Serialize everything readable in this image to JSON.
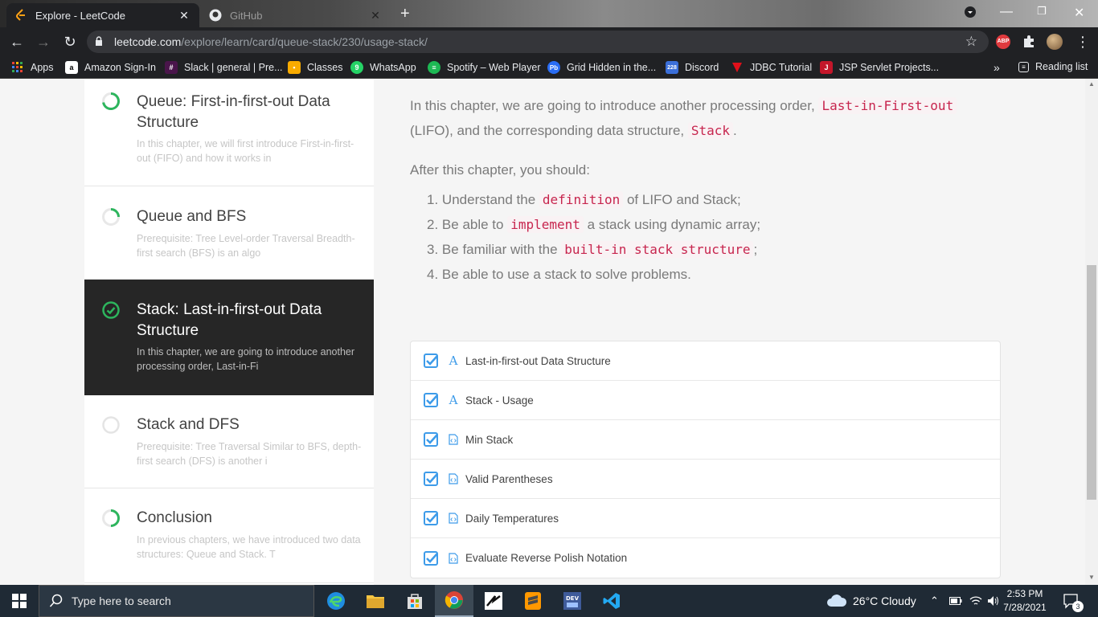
{
  "browser": {
    "tabs": [
      {
        "title": "Explore - LeetCode",
        "active": true
      },
      {
        "title": "GitHub",
        "active": false
      }
    ],
    "url_host": "leetcode.com",
    "url_path": "/explore/learn/card/queue-stack/230/usage-stack/",
    "ext_badge": "ABP"
  },
  "bookmarks": [
    {
      "label": "Apps",
      "icon": "apps-grid-icon",
      "color": "#ea4335"
    },
    {
      "label": "Amazon Sign-In",
      "icon": "amazon-icon",
      "color": "#ffffff"
    },
    {
      "label": "Slack | general | Pre...",
      "icon": "slack-icon",
      "color": "#4a154b"
    },
    {
      "label": "Classes",
      "icon": "classroom-icon",
      "color": "#f9ab00"
    },
    {
      "label": "WhatsApp",
      "icon": "whatsapp-icon",
      "color": "#25d366"
    },
    {
      "label": "Spotify – Web Player",
      "icon": "spotify-icon",
      "color": "#1db954"
    },
    {
      "label": "Grid Hidden in the...",
      "icon": "pb-icon",
      "color": "#2a6df4"
    },
    {
      "label": "Discord",
      "icon": "calendar-icon",
      "color": "#3b6fd9"
    },
    {
      "label": "JDBC Tutorial",
      "icon": "javatpoint-icon",
      "color": "#e0101a"
    },
    {
      "label": "JSP Servlet Projects...",
      "icon": "jsp-icon",
      "color": "#c4162a"
    }
  ],
  "reading_list_label": "Reading list",
  "sidebar": {
    "chapters": [
      {
        "title": "Queue: First-in-first-out Data Structure",
        "desc": "In this chapter, we will first introduce First-in-first-out (FIFO) and how it works in",
        "status": "in-progress"
      },
      {
        "title": "Queue and BFS",
        "desc": "Prerequisite: Tree Level-order Traversal Breadth-first search (BFS) is an algo",
        "status": "in-progress"
      },
      {
        "title": "Stack: Last-in-first-out Data Structure",
        "desc": "In this chapter, we are going to introduce another processing order, Last-in-Fi",
        "status": "completed"
      },
      {
        "title": "Stack and DFS",
        "desc": "Prerequisite: Tree Traversal Similar to BFS, depth-first search (DFS) is another i",
        "status": "not-started"
      },
      {
        "title": "Conclusion",
        "desc": "In previous chapters, we have introduced two data structures: Queue and Stack. T",
        "status": "in-progress"
      }
    ]
  },
  "content": {
    "intro_1": "In this chapter, we are going to introduce another processing order,",
    "intro_code_1": "Last-in-First-out",
    "intro_2": "(LIFO), and the corresponding data structure,",
    "intro_code_2": "Stack",
    "intro_3": ".",
    "after_text": "After this chapter, you should:",
    "objectives": [
      {
        "num": "1.",
        "pre": "Understand the",
        "code": "definition",
        "post": "of LIFO and Stack;"
      },
      {
        "num": "2.",
        "pre": "Be able to",
        "code": "implement",
        "post": "a stack using dynamic array;"
      },
      {
        "num": "3.",
        "pre": "Be familiar with the",
        "code": "built-in stack structure",
        "post": ";"
      },
      {
        "num": "4.",
        "pre": "Be able to use a stack to solve problems.",
        "code": "",
        "post": ""
      }
    ],
    "lessons": [
      {
        "title": "Last-in-first-out Data Structure",
        "kind": "article"
      },
      {
        "title": "Stack - Usage",
        "kind": "article"
      },
      {
        "title": "Min Stack",
        "kind": "code"
      },
      {
        "title": "Valid Parentheses",
        "kind": "code"
      },
      {
        "title": "Daily Temperatures",
        "kind": "code"
      },
      {
        "title": "Evaluate Reverse Polish Notation",
        "kind": "code"
      }
    ]
  },
  "taskbar": {
    "search_placeholder": "Type here to search",
    "weather": "26°C  Cloudy",
    "time": "2:53 PM",
    "date": "7/28/2021",
    "notifications": "3"
  },
  "colors": {
    "accent": "#2db55d",
    "check": "#3d9be9",
    "code": "#c7254e"
  }
}
